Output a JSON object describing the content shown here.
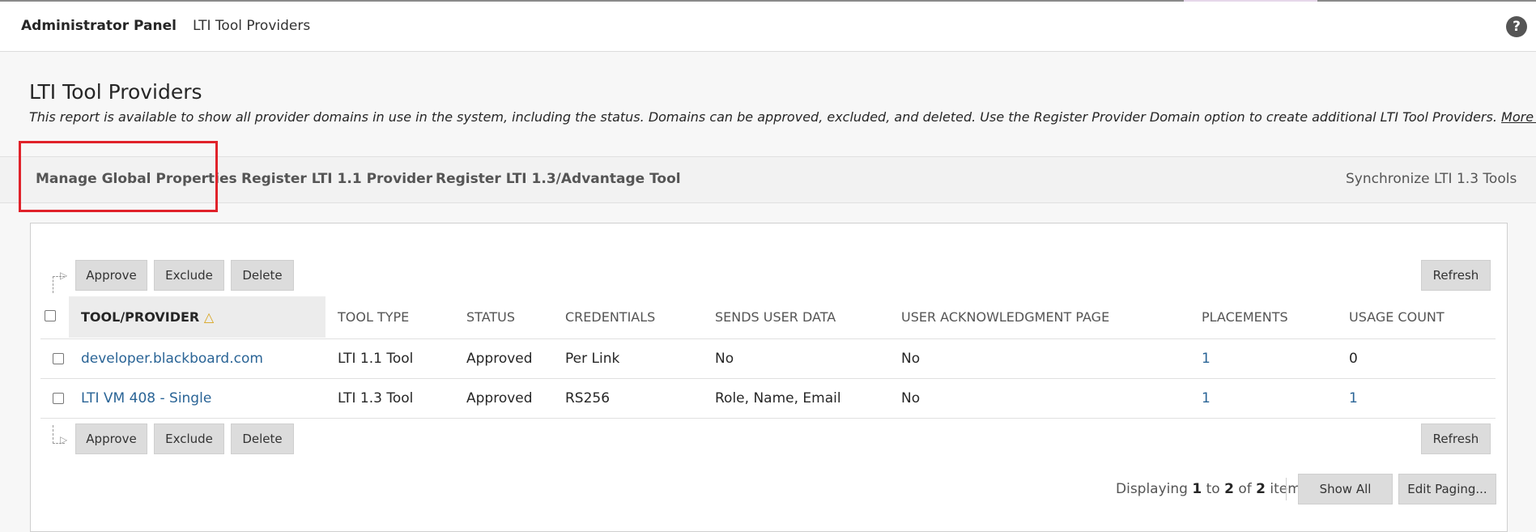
{
  "breadcrumb": {
    "panel": "Administrator Panel",
    "current": "LTI Tool Providers"
  },
  "help": "?",
  "page": {
    "title": "LTI Tool Providers",
    "description": "This report is available to show all provider domains in use in the system, including the status. Domains can be approved, excluded, and deleted. Use the Register Provider Domain option to create additional LTI Tool Providers.",
    "more_help": "More Help"
  },
  "actions": {
    "manage_global": "Manage Global Properties",
    "register_11": "Register LTI 1.1 Provider",
    "register_13": "Register LTI 1.3/Advantage Tool",
    "synchronize": "Synchronize LTI 1.3 Tools"
  },
  "buttons": {
    "approve": "Approve",
    "exclude": "Exclude",
    "delete": "Delete",
    "refresh": "Refresh",
    "show_all": "Show All",
    "edit_paging": "Edit Paging..."
  },
  "table": {
    "headers": {
      "tool_provider": "TOOL/PROVIDER",
      "tool_type": "TOOL TYPE",
      "status": "STATUS",
      "credentials": "CREDENTIALS",
      "sends_user_data": "SENDS USER DATA",
      "user_ack": "USER ACKNOWLEDGMENT PAGE",
      "placements": "PLACEMENTS",
      "usage_count": "USAGE COUNT"
    },
    "rows": [
      {
        "tool_provider": "developer.blackboard.com",
        "tool_type": "LTI 1.1 Tool",
        "status": "Approved",
        "credentials": "Per Link",
        "sends_user_data": "No",
        "user_ack": "No",
        "placements": "1",
        "usage_count": "0"
      },
      {
        "tool_provider": "LTI VM 408 - Single",
        "tool_type": "LTI 1.3 Tool",
        "status": "Approved",
        "credentials": "RS256",
        "sends_user_data": "Role, Name, Email",
        "user_ack": "No",
        "placements": "1",
        "usage_count": "1"
      }
    ]
  },
  "paging": {
    "prefix": "Displaying",
    "from": "1",
    "to_word": "to",
    "to": "2",
    "of_word": "of",
    "total": "2",
    "suffix": "items"
  },
  "colors": {
    "link": "#2a6496",
    "highlight": "#e0222a",
    "button": "#dcdcdc"
  }
}
